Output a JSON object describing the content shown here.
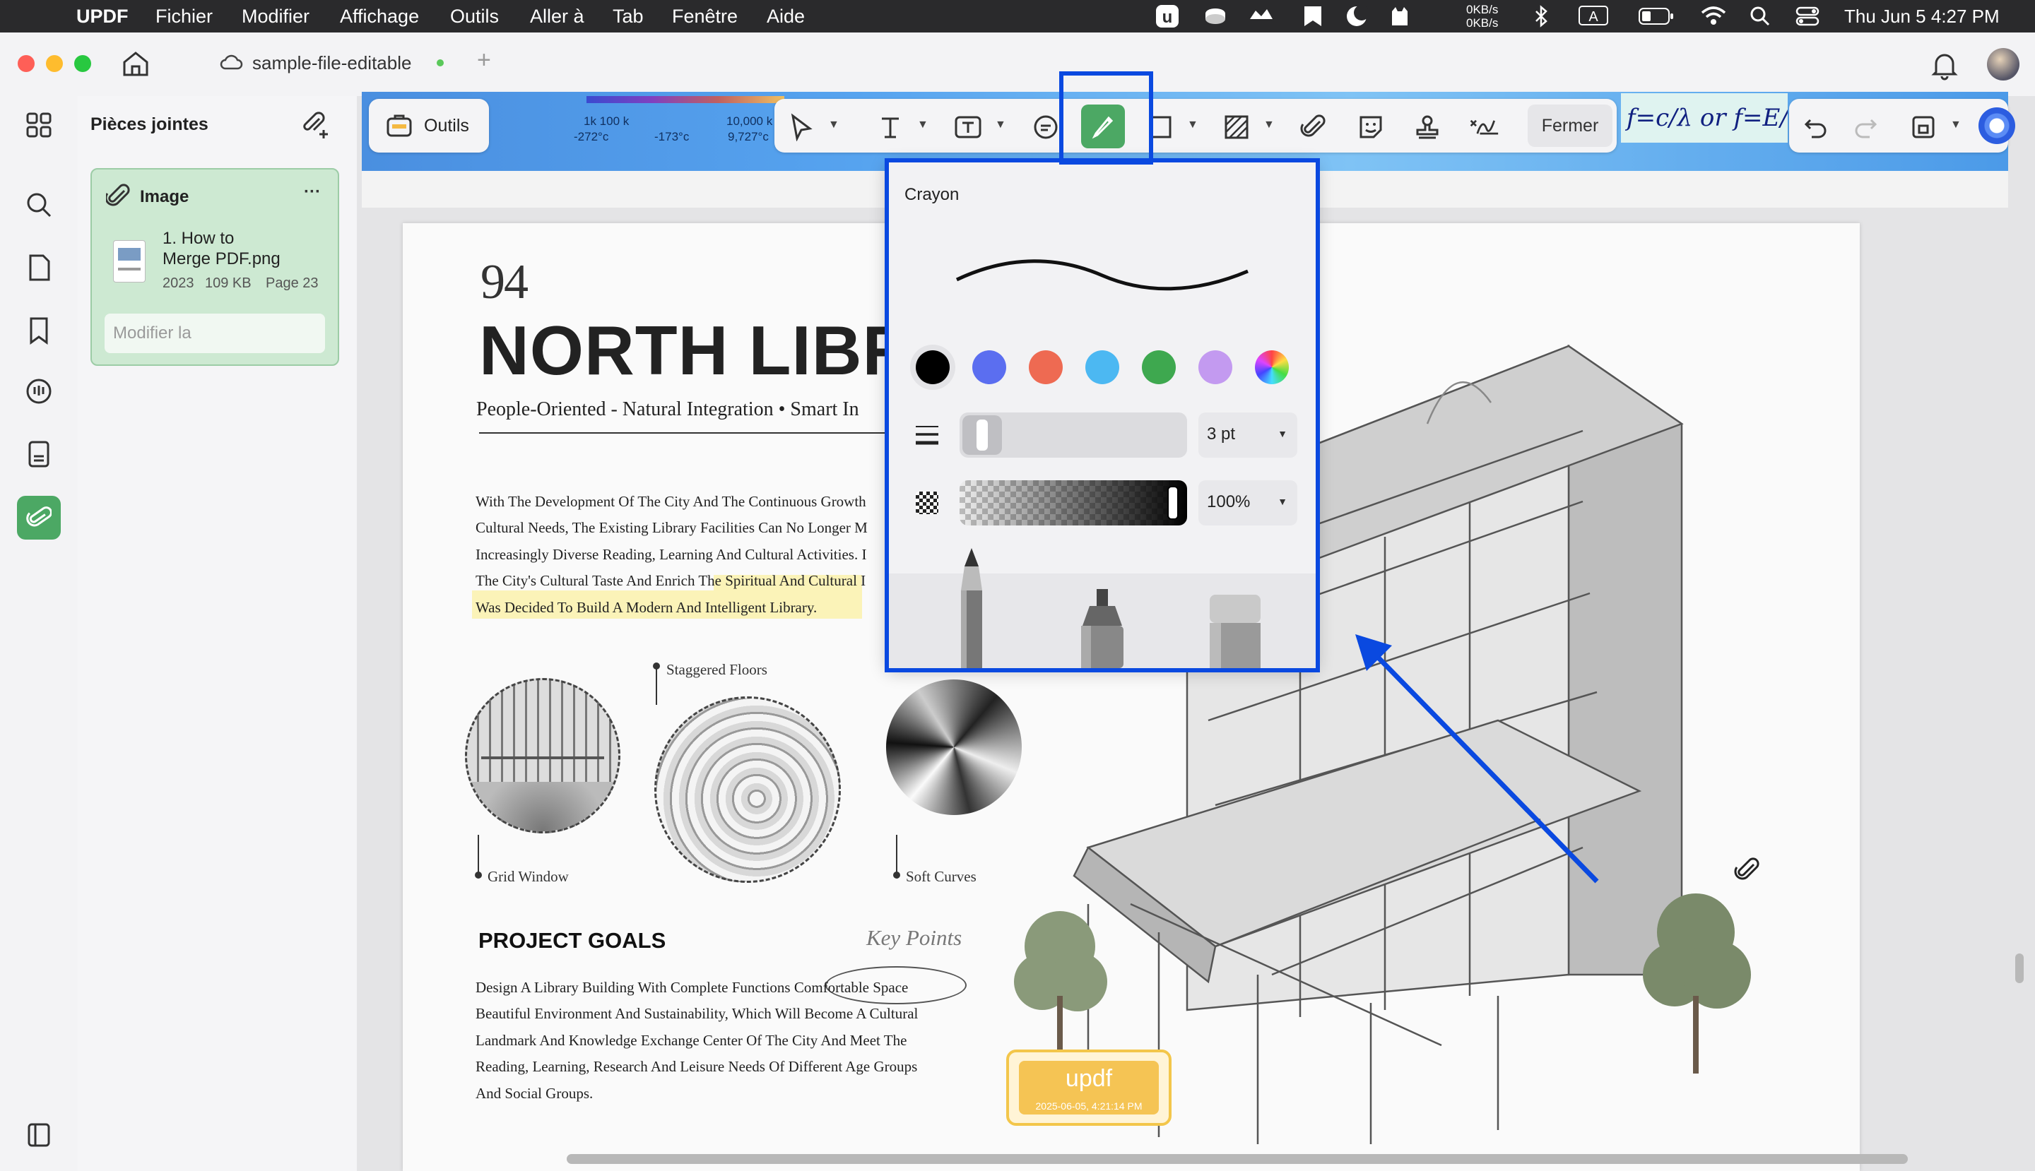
{
  "menubar": {
    "app_name": "UPDF",
    "items": [
      "Fichier",
      "Modifier",
      "Affichage",
      "Outils",
      "Aller à",
      "Tab",
      "Fenêtre",
      "Aide"
    ],
    "net_up": "0KB/s",
    "net_down": "0KB/s",
    "keyboard": "A",
    "datetime": "Thu Jun 5  4:27 PM"
  },
  "tab": {
    "title": "sample-file-editable",
    "add_label": "+"
  },
  "panel": {
    "title": "Pièces jointes",
    "attachment": {
      "type_label": "Image",
      "more": "···",
      "file_name_line1": "1. How to",
      "file_name_line2": "Merge PDF.png",
      "year": "2023",
      "size": "109 KB",
      "page": "Page 23",
      "edit_placeholder": "Modifier la"
    }
  },
  "toolbar": {
    "tools_label": "Outils",
    "close_label": "Fermer",
    "header_band": {
      "left_label_top": "1k 100 k",
      "left_label_bottom": "-272°c",
      "mid_label": "-173°c",
      "right_label_top": "10,000 k",
      "right_label_bottom": "9,727°c",
      "formula": "f=c/λ or f=E/h"
    }
  },
  "popover": {
    "title": "Crayon",
    "colors": [
      "#000000",
      "#5b6ef0",
      "#ee6a52",
      "#4cb8f2",
      "#3ea84f",
      "#c39af0"
    ],
    "stroke_width": "3 pt",
    "opacity": "100%"
  },
  "document": {
    "page_number": "94",
    "title": "NORTH LIBR",
    "subtitle": "People-Oriented - Natural Integration • Smart In",
    "intro_lines": [
      "With The Development Of The City And The Continuous Growth",
      "Cultural Needs, The Existing Library Facilities Can No Longer M",
      "Increasingly Diverse Reading, Learning And Cultural Activities. I",
      "The City's Cultural Taste And Enrich The Spiritual And Cultural I",
      "Was Decided To Build A Modern And Intelligent Library."
    ],
    "captions": {
      "staggered": "Staggered Floors",
      "grid": "Grid Window",
      "soft": "Soft Curves"
    },
    "goals_heading": "PROJECT GOALS",
    "key_points": "Key Points",
    "goals_lines": [
      "Design A Library Building With Complete Functions Comfortable Space",
      "Beautiful Environment And Sustainability, Which Will Become A Cultural",
      "Landmark And Knowledge Exchange Center Of The City And Meet The",
      "Reading, Learning, Research And Leisure Needs Of Different Age Groups",
      "And Social Groups."
    ],
    "stamp_text": "updf",
    "stamp_date": "2025-06-05, 4:21:14 PM"
  }
}
